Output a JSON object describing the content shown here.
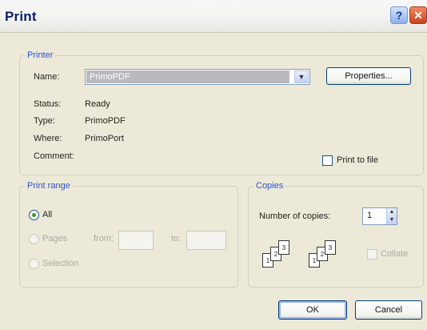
{
  "window": {
    "title": "Print"
  },
  "printer": {
    "legend": "Printer",
    "name_label": "Name:",
    "name_value": "PrimoPDF",
    "properties_label": "Properties...",
    "status_label": "Status:",
    "status_value": "Ready",
    "type_label": "Type:",
    "type_value": "PrimoPDF",
    "where_label": "Where:",
    "where_value": "PrimoPort",
    "comment_label": "Comment:",
    "print_to_file_label": "Print to file"
  },
  "print_range": {
    "legend": "Print range",
    "all_label": "All",
    "pages_label": "Pages",
    "from_label": "from:",
    "to_label": "to:",
    "selection_label": "Selection",
    "selected": "All"
  },
  "copies": {
    "legend": "Copies",
    "number_label": "Number of copies:",
    "number_value": "1",
    "collate_label": "Collate"
  },
  "buttons": {
    "ok": "OK",
    "cancel": "Cancel"
  }
}
